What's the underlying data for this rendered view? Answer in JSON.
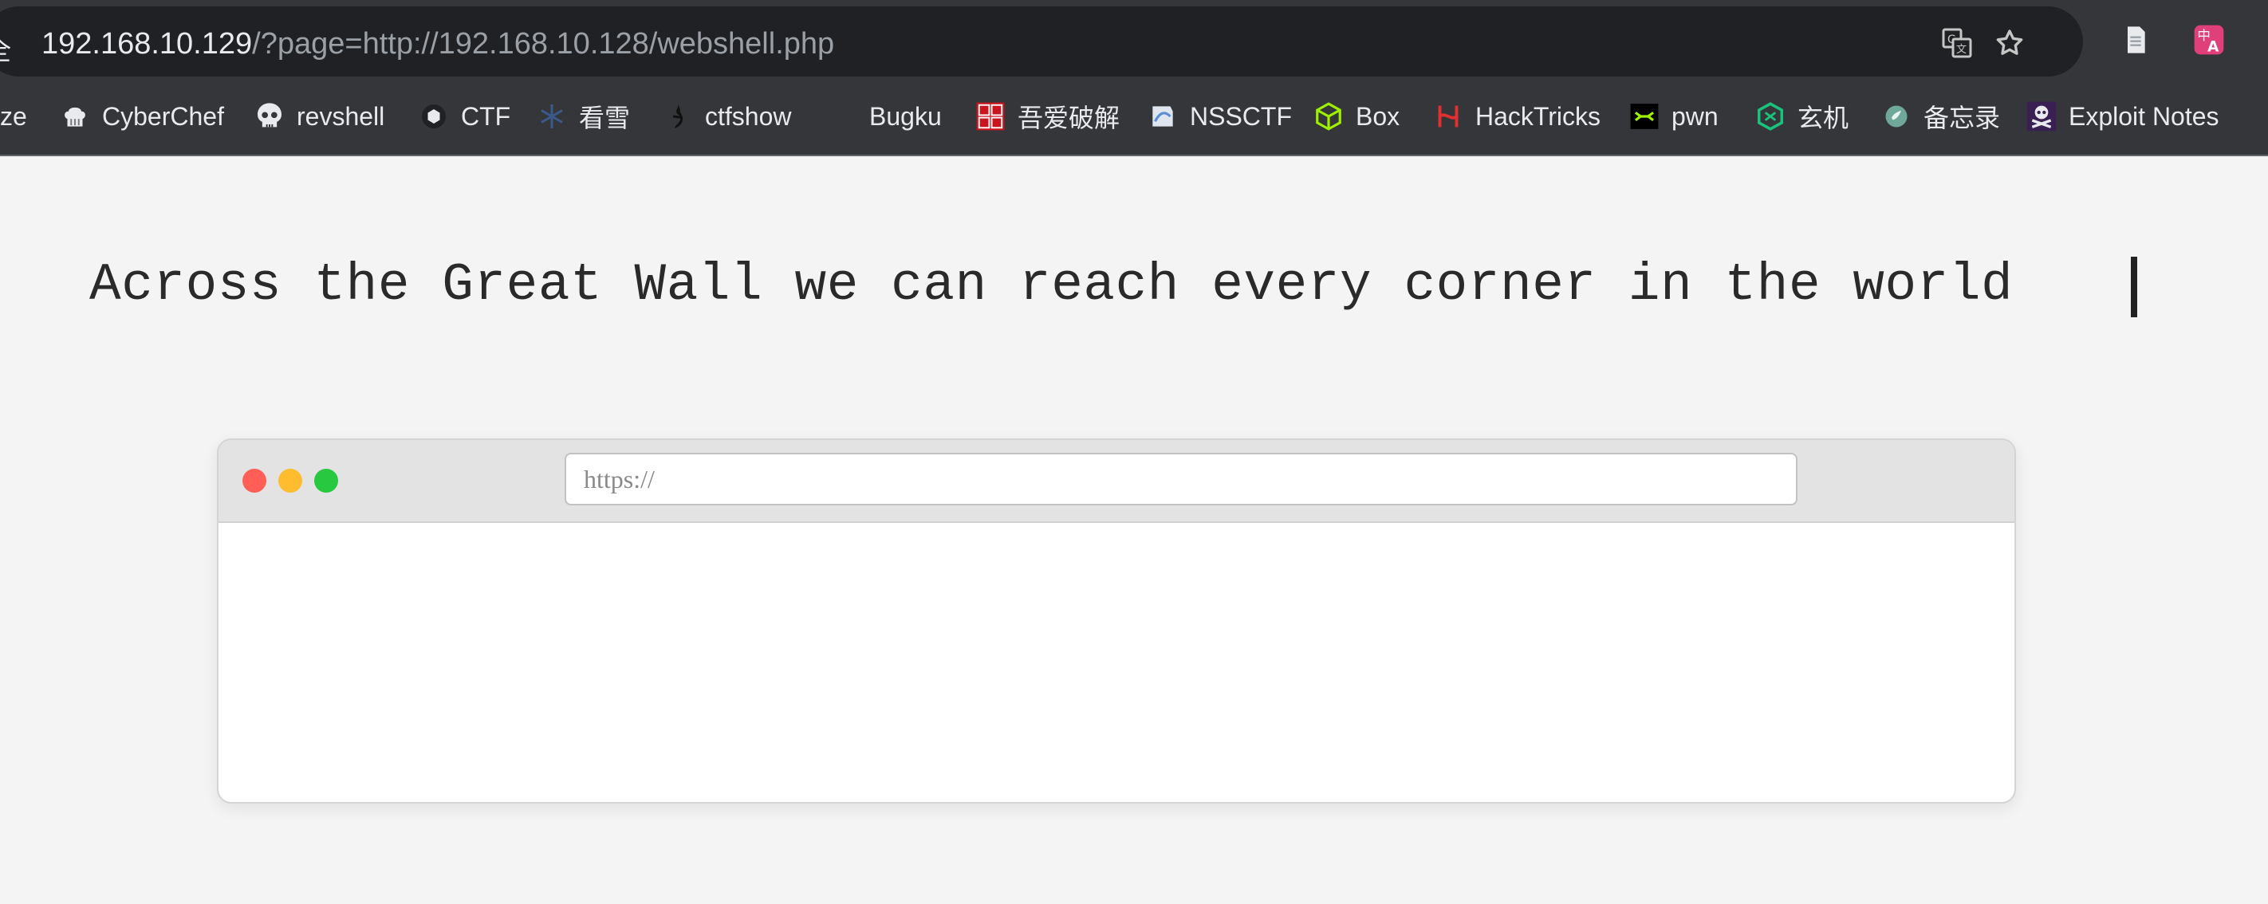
{
  "browser": {
    "site_info_label": "全",
    "url_host": "192.168.10.129",
    "url_rest": "/?page=http://192.168.10.128/webshell.php",
    "icons": [
      "translate-icon",
      "star-icon",
      "reading-list-icon",
      "extension-translate-icon"
    ]
  },
  "bookmarks": [
    {
      "label": "ze",
      "icon": "none"
    },
    {
      "label": "CyberChef",
      "icon": "chef-hat-icon"
    },
    {
      "label": "revshell",
      "icon": "skull-icon"
    },
    {
      "label": "CTF",
      "icon": "ctf-icon"
    },
    {
      "label": "看雪",
      "icon": "snowflake-icon"
    },
    {
      "label": "ctfshow",
      "icon": "ctfshow-icon"
    },
    {
      "label": "Bugku",
      "icon": "bugku-icon"
    },
    {
      "label": "吾爱破解",
      "icon": "52pojie-icon"
    },
    {
      "label": "NSSCTF",
      "icon": "nssctf-icon"
    },
    {
      "label": "Box",
      "icon": "cube-icon"
    },
    {
      "label": "HackTricks",
      "icon": "hacktricks-icon"
    },
    {
      "label": "pwn",
      "icon": "pwn-icon"
    },
    {
      "label": "玄机",
      "icon": "hexagon-icon"
    },
    {
      "label": "备忘录",
      "icon": "memo-icon"
    },
    {
      "label": "Exploit Notes",
      "icon": "skull-crossbones-icon"
    }
  ],
  "page": {
    "headline": "Across the Great Wall we can reach every corner in the world",
    "window": {
      "url_placeholder": "https://",
      "url_value": ""
    }
  },
  "colors": {
    "chrome_bg": "#35363a",
    "omnibox_bg": "#202124",
    "page_bg": "#f4f4f4",
    "dot_close": "#ff5f57",
    "dot_minimize": "#febc2e",
    "dot_zoom": "#28c840"
  }
}
